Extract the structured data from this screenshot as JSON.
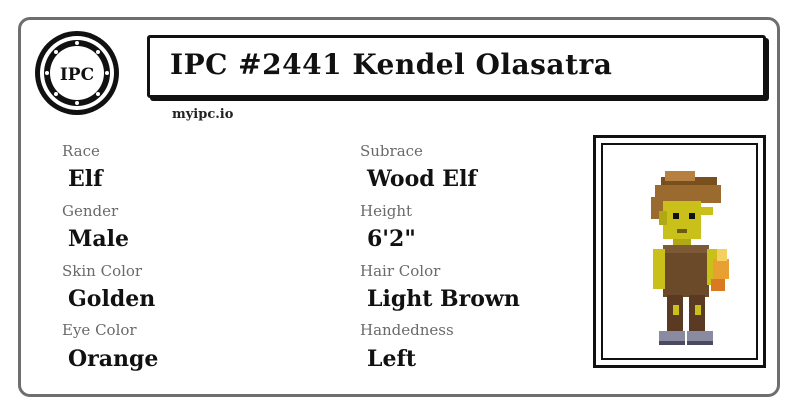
{
  "header": {
    "title": "IPC #2441 Kendel Olasatra",
    "site": "myipc.io",
    "logo_text": "IPC"
  },
  "fields": [
    {
      "label": "Race",
      "value": "Elf"
    },
    {
      "label": "Subrace",
      "value": "Wood Elf"
    },
    {
      "label": "Gender",
      "value": "Male"
    },
    {
      "label": "Height",
      "value": "6'2\""
    },
    {
      "label": "Skin Color",
      "value": "Golden"
    },
    {
      "label": "Hair Color",
      "value": "Light Brown"
    },
    {
      "label": "Eye Color",
      "value": "Orange"
    },
    {
      "label": "Handedness",
      "value": "Left"
    }
  ],
  "portrait": {
    "description_icon": "elf-character-sprite-icon"
  },
  "colors": {
    "border": "#6e6e6e",
    "ink": "#111111",
    "label": "#6a6a6a",
    "skin": "#c9c11a",
    "hair": "#9a6a2e"
  }
}
